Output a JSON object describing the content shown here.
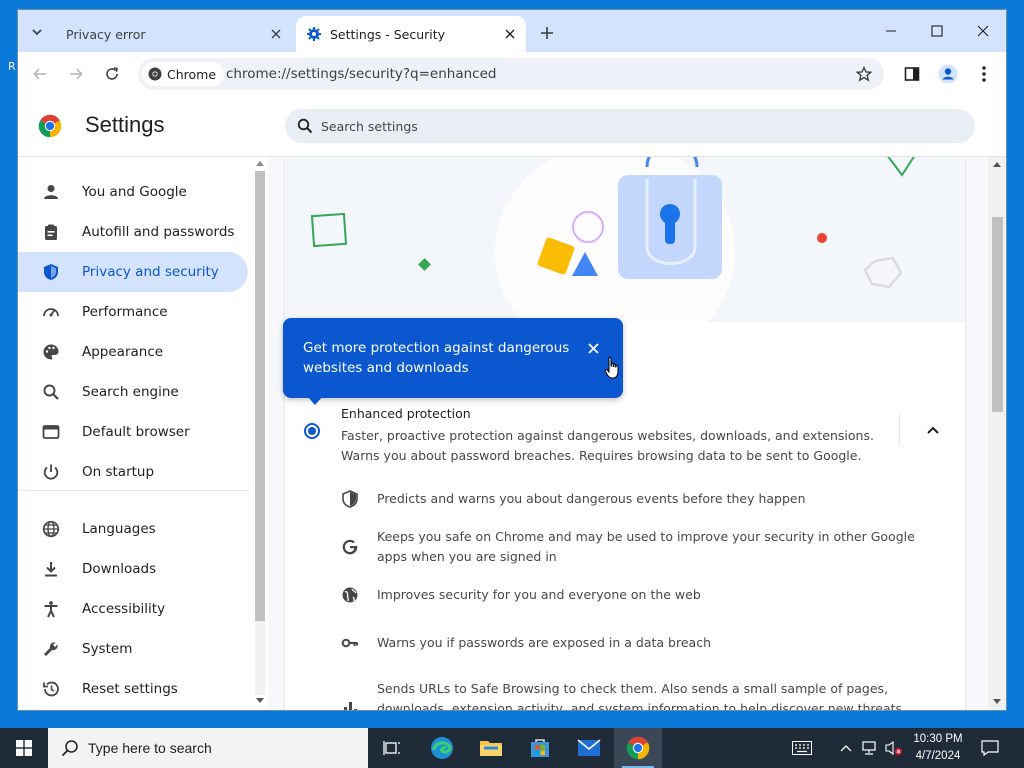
{
  "browser": {
    "tabs": [
      {
        "title": "Privacy error",
        "active": false
      },
      {
        "title": "Settings - Security",
        "active": true
      }
    ],
    "chip_label": "Chrome",
    "url": "chrome://settings/security?q=enhanced"
  },
  "settings": {
    "title": "Settings",
    "search_placeholder": "Search settings",
    "sidebar": {
      "items": [
        {
          "label": "You and Google",
          "icon": "person-icon"
        },
        {
          "label": "Autofill and passwords",
          "icon": "clipboard-icon"
        },
        {
          "label": "Privacy and security",
          "icon": "shield-icon",
          "selected": true
        },
        {
          "label": "Performance",
          "icon": "speedometer-icon"
        },
        {
          "label": "Appearance",
          "icon": "palette-icon"
        },
        {
          "label": "Search engine",
          "icon": "search-icon"
        },
        {
          "label": "Default browser",
          "icon": "browser-window-icon"
        },
        {
          "label": "On startup",
          "icon": "power-icon"
        },
        {
          "label": "Languages",
          "icon": "globe-icon"
        },
        {
          "label": "Downloads",
          "icon": "download-icon"
        },
        {
          "label": "Accessibility",
          "icon": "accessibility-icon"
        },
        {
          "label": "System",
          "icon": "wrench-icon"
        },
        {
          "label": "Reset settings",
          "icon": "history-icon"
        }
      ]
    },
    "tooltip": {
      "text": "Get more protection against dangerous websites and downloads"
    },
    "enhanced": {
      "title": "Enhanced protection",
      "description": "Faster, proactive protection against dangerous websites, downloads, and extensions. Warns you about password breaches. Requires browsing data to be sent to Google.",
      "selected": true,
      "features": [
        {
          "icon": "shield-icon",
          "text": "Predicts and warns you about dangerous events before they happen"
        },
        {
          "icon": "google-g-icon",
          "text": "Keeps you safe on Chrome and may be used to improve your security in other Google apps when you are signed in"
        },
        {
          "icon": "globe-icon",
          "text": "Improves security for you and everyone on the web"
        },
        {
          "icon": "key-icon",
          "text": "Warns you if passwords are exposed in a data breach"
        },
        {
          "icon": "bar-chart-icon",
          "text": "Sends URLs to Safe Browsing to check them. Also sends a small sample of pages, downloads, extension activity, and system information to help discover new threats. Temporarily links this data"
        }
      ]
    }
  },
  "taskbar": {
    "search_placeholder": "Type here to search",
    "time": "10:30 PM",
    "date": "4/7/2024"
  },
  "colors": {
    "accent": "#0b57d0",
    "selected_bg": "#d3e3fd",
    "taskbar": "#1f2b38",
    "desktop": "#0a78d7"
  }
}
